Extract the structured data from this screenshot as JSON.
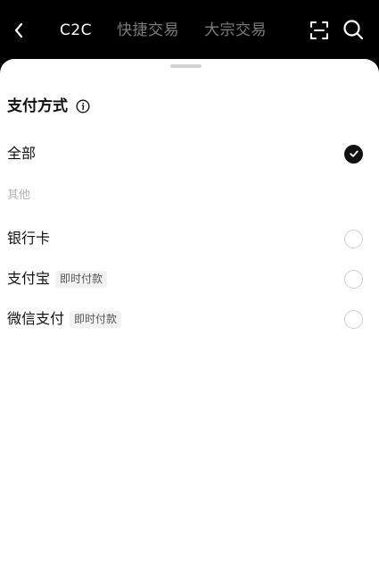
{
  "header": {
    "tabs": [
      {
        "label": "C2C",
        "active": true
      },
      {
        "label": "快捷交易",
        "active": false
      },
      {
        "label": "大宗交易",
        "active": false
      }
    ],
    "icons": {
      "back": "chevron-left-icon",
      "scan": "scan-icon",
      "search": "search-icon"
    }
  },
  "sheet": {
    "title": "支付方式",
    "title_icon": "info-icon",
    "all_option": {
      "label": "全部",
      "selected": true
    },
    "section_label": "其他",
    "methods": [
      {
        "label": "银行卡",
        "badge": "",
        "selected": false
      },
      {
        "label": "支付宝",
        "badge": "即时付款",
        "selected": false
      },
      {
        "label": "微信支付",
        "badge": "即时付款",
        "selected": false
      }
    ]
  },
  "colors": {
    "accent": "#111111",
    "background": "#ffffff",
    "header": "#000000",
    "muted": "#b4b4b4"
  }
}
